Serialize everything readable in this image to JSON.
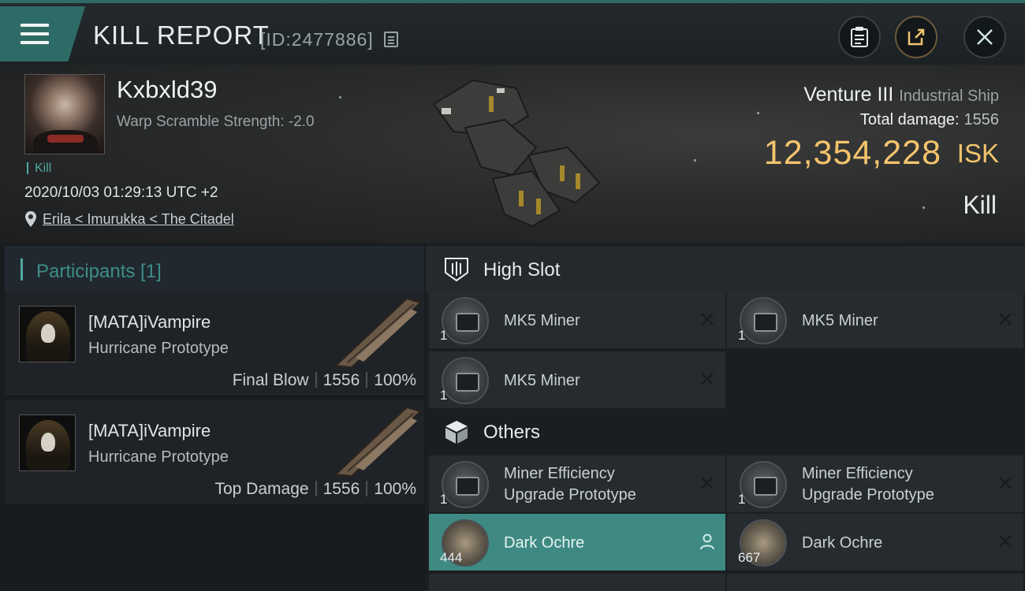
{
  "header": {
    "title": "KILL REPORT",
    "kill_id": "[ID:2477886]"
  },
  "victim": {
    "pilot_name": "Kxbxld39",
    "warp_scramble": "Warp Scramble Strength: -2.0",
    "kill_tag": "Kill",
    "timestamp": "2020/10/03 01:29:13 UTC +2",
    "location": "Erila < Imurukka < The Citadel",
    "ship_name": "Venture III",
    "ship_class": "Industrial Ship",
    "total_damage_label": "Total damage:",
    "total_damage": "1556",
    "isk_value": "12,354,228",
    "isk_unit": "ISK",
    "result": "Kill"
  },
  "participants": {
    "title": "Participants [1]",
    "rows": [
      {
        "name": "[MATA]iVampire",
        "ship": "Hurricane Prototype",
        "role": "Final Blow",
        "damage": "1556",
        "percent": "100%"
      },
      {
        "name": "[MATA]iVampire",
        "ship": "Hurricane Prototype",
        "role": "Top Damage",
        "damage": "1556",
        "percent": "100%"
      }
    ]
  },
  "fittings": {
    "high_slot_title": "High Slot",
    "others_title": "Others",
    "high_slot": [
      {
        "name": "MK5 Miner",
        "qty": "1"
      },
      {
        "name": "MK5 Miner",
        "qty": "1"
      },
      {
        "name": "MK5 Miner",
        "qty": "1"
      }
    ],
    "others": [
      {
        "name_line1": "Miner Efficiency",
        "name_line2": "Upgrade Prototype",
        "qty": "1"
      },
      {
        "name_line1": "Miner Efficiency",
        "name_line2": "Upgrade Prototype",
        "qty": "1"
      },
      {
        "name": "Dark Ochre",
        "qty": "444",
        "state": "dropped"
      },
      {
        "name": "Dark Ochre",
        "qty": "667",
        "state": "destroyed"
      }
    ]
  },
  "colors": {
    "accent": "#2f6b66",
    "isk": "#f4c46d",
    "highlight_row": "#3e8a83"
  }
}
